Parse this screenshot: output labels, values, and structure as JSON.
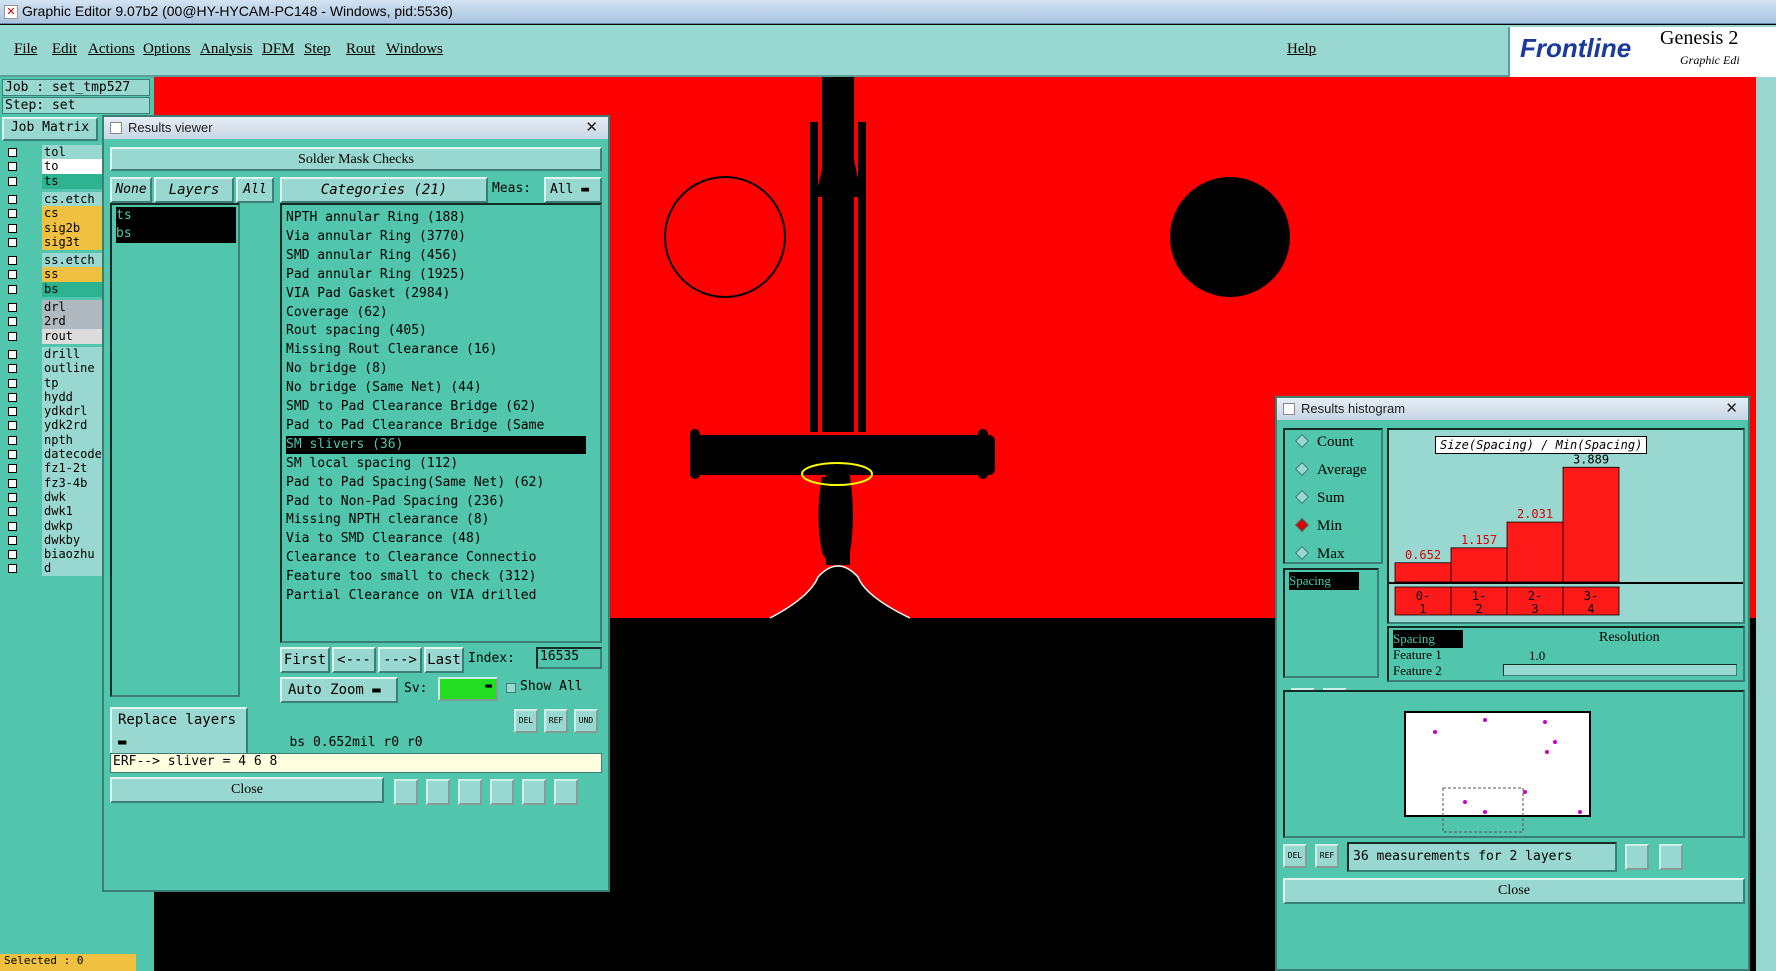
{
  "window": {
    "title": "Graphic Editor 9.07b2 (00@HY-HYCAM-PC148 - Windows, pid:5536)"
  },
  "menu": {
    "items": [
      "File",
      "Edit",
      "Actions",
      "Options",
      "Analysis",
      "DFM",
      "Step",
      "Rout",
      "Windows"
    ],
    "help": "Help"
  },
  "brand": {
    "logo": "Frontline",
    "product": "Genesis 2",
    "sub": "Graphic Edi"
  },
  "job": {
    "job_label": "Job : set_tmp527",
    "step_label": "Step: set",
    "matrix_button": "Job Matrix"
  },
  "layers": [
    {
      "name": "tol",
      "color": "#99d8d1"
    },
    {
      "name": "to",
      "color": "#ffffff"
    },
    {
      "name": "ts",
      "color": "#2db38f"
    },
    {
      "name": "cs.etch",
      "color": "#99d8d1"
    },
    {
      "name": "cs",
      "color": "#f0c040"
    },
    {
      "name": "sig2b",
      "color": "#f0c040"
    },
    {
      "name": "sig3t",
      "color": "#f0c040"
    },
    {
      "name": "ss.etch",
      "color": "#99d8d1"
    },
    {
      "name": "ss",
      "color": "#f0c040"
    },
    {
      "name": "bs",
      "color": "#2db38f"
    },
    {
      "name": "drl",
      "color": "#b0b8c0"
    },
    {
      "name": "2rd",
      "color": "#b0b8c0"
    },
    {
      "name": "rout",
      "color": "#dcdcdc"
    },
    {
      "name": "drill",
      "color": "#99d8d1"
    },
    {
      "name": "outline",
      "color": "#99d8d1"
    },
    {
      "name": "tp",
      "color": "#99d8d1"
    },
    {
      "name": "hydd",
      "color": "#99d8d1"
    },
    {
      "name": "ydkdrl",
      "color": "#99d8d1"
    },
    {
      "name": "ydk2rd",
      "color": "#99d8d1"
    },
    {
      "name": "npth",
      "color": "#99d8d1"
    },
    {
      "name": "datecode-",
      "color": "#99d8d1"
    },
    {
      "name": "fz1-2t",
      "color": "#99d8d1"
    },
    {
      "name": "fz3-4b",
      "color": "#99d8d1"
    },
    {
      "name": "dwk",
      "color": "#99d8d1"
    },
    {
      "name": "dwk1",
      "color": "#99d8d1"
    },
    {
      "name": "dwkp",
      "color": "#99d8d1"
    },
    {
      "name": "dwkby",
      "color": "#99d8d1"
    },
    {
      "name": "biaozhu",
      "color": "#99d8d1"
    },
    {
      "name": "d",
      "color": "#99d8d1"
    }
  ],
  "status": {
    "selected": "Selected : 0"
  },
  "results_viewer": {
    "title": "Results viewer",
    "header": "Solder Mask Checks",
    "none_btn": "None",
    "layers_btn": "Layers",
    "all_btn": "All",
    "categories_btn": "Categories (21)",
    "meas_label": "Meas:",
    "meas_value": "All",
    "layer_list": [
      "ts",
      "bs"
    ],
    "categories": [
      "NPTH annular Ring (188)",
      "Via annular Ring (3770)",
      "SMD annular Ring (456)",
      "Pad annular Ring (1925)",
      "VIA Pad Gasket (2984)",
      "Coverage (62)",
      "Rout spacing (405)",
      "Missing Rout Clearance (16)",
      "No bridge (8)",
      "No bridge (Same Net) (44)",
      "SMD to Pad Clearance Bridge (62)",
      "Pad to Pad Clearance Bridge (Same",
      "SM slivers (36)",
      "SM local spacing (112)",
      "Pad to Pad Spacing(Same Net) (62)",
      "Pad to Non-Pad Spacing (236)",
      "Missing NPTH clearance (8)",
      "Via to SMD Clearance (48)",
      "Clearance to Clearance Connectio",
      "Feature too small to check (312)",
      "Partial Clearance on VIA drilled"
    ],
    "selected_category": "SM slivers (36)",
    "first_btn": "First",
    "prev_btn": "<---",
    "next_btn": "--->",
    "last_btn": "Last",
    "index_label": "Index:",
    "index_value": "16535",
    "autozoom_btn": "Auto Zoom",
    "sv_label": "Sv:",
    "showall_label": "Show All",
    "replace_btn": "Replace layers",
    "info_line": "bs 0.652mil  r0  r0",
    "erf_line": "ERF--> sliver = 4 6 8",
    "close_btn": "Close"
  },
  "histogram": {
    "title": "Results histogram",
    "modes": [
      "Count",
      "Average",
      "Sum",
      "Min",
      "Max"
    ],
    "selected_mode": "Min",
    "list": [
      "Spacing"
    ],
    "chart_title": "Size(Spacing) / Min(Spacing)",
    "resolution_label": "Resolution",
    "resolution_value": "1.0",
    "measure_list": [
      "Spacing",
      "Feature 1",
      "Feature 2"
    ],
    "summary": "36 measurements for 2 layers",
    "close_btn": "Close"
  },
  "chart_data": {
    "type": "bar",
    "categories": [
      "0-1",
      "1-2",
      "2-3",
      "3-4"
    ],
    "values": [
      0.652,
      1.157,
      2.031,
      3.889
    ],
    "title": "Size(Spacing) / Min(Spacing)",
    "ylim": [
      0,
      4
    ],
    "color": "#ff1a1a"
  }
}
